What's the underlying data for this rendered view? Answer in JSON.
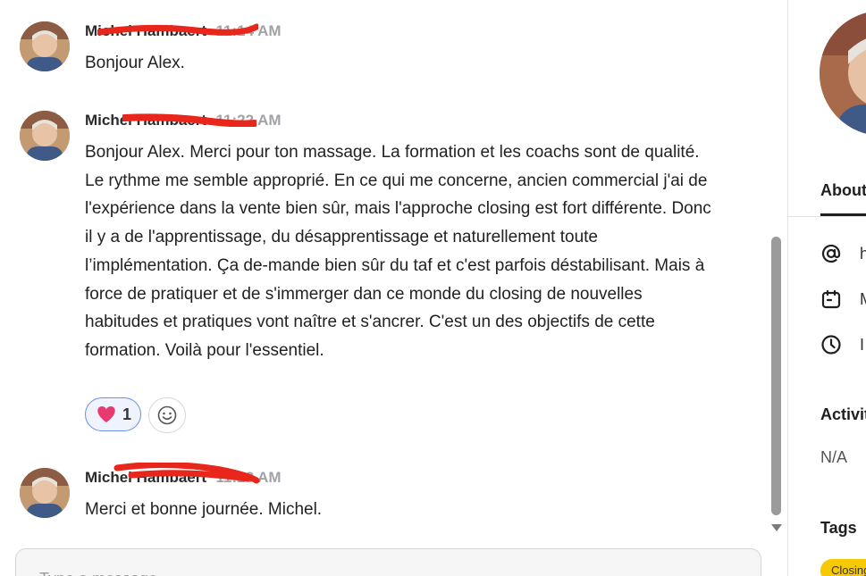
{
  "messages": [
    {
      "author": "Michel Hambaert",
      "time": "11:14 AM",
      "text": "Bonjour Alex."
    },
    {
      "author": "Michel Hambaert",
      "time": "11:22 AM",
      "text": "Bonjour Alex. Merci pour ton massage. La formation et les coachs sont de qualité. Le rythme me semble approprié. En ce qui me concerne, ancien commercial j'ai de l'expérience dans la vente bien sûr, mais l'approche closing est fort différente. Donc il y a de l'apprentissage, du désapprentissage et naturellement toute l’implémentation. Ça de-mande bien sûr du taf et c'est parfois déstabilisant. Mais à force de pratiquer et de s'immerger dan ce monde du closing de nouvelles habitudes et pratiques vont naître et s'ancrer. C'est un des objectifs de cette formation. Voilà pour l'essentiel.",
      "reaction": {
        "emoji": "heart",
        "count": "1"
      }
    },
    {
      "author": "Michel Hambaert",
      "time": "11:23 AM",
      "text": "Merci et bonne journée. Michel."
    }
  ],
  "composer": {
    "placeholder": "Type a message"
  },
  "sidebar": {
    "tab_about": "About",
    "rows": [
      {
        "icon": "at-icon",
        "text": "h"
      },
      {
        "icon": "calendar-icon",
        "text": "M"
      },
      {
        "icon": "clock-icon",
        "text": "I"
      }
    ],
    "activity_title": "Activity",
    "activity_value": "N/A",
    "tags_title": "Tags",
    "tags": [
      "Closing"
    ]
  },
  "colors": {
    "redaction": "#e8261c",
    "accent": "#6b8fe8",
    "tag": "#f7c900"
  }
}
